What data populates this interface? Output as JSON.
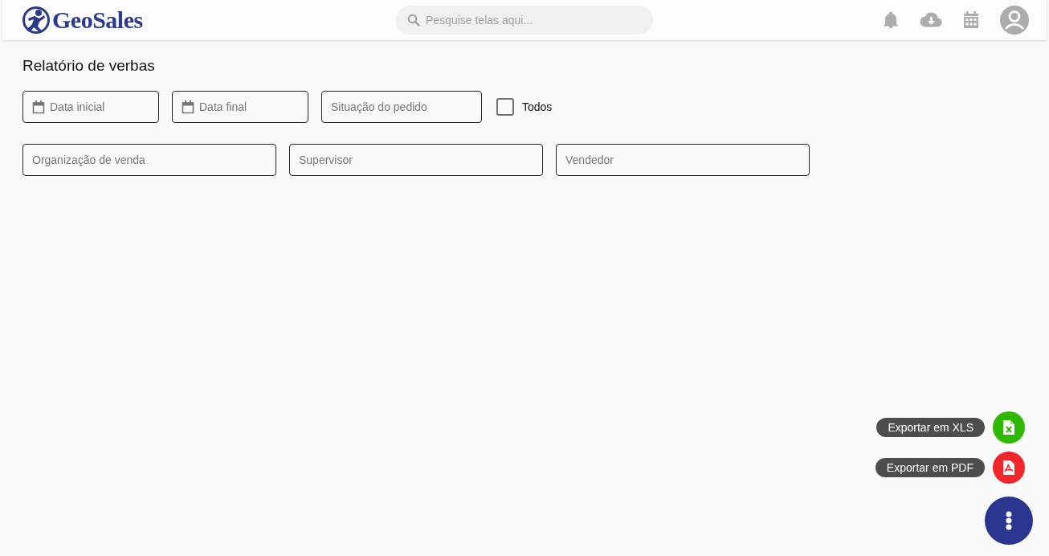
{
  "header": {
    "logo_text": "GeoSales",
    "search": {
      "placeholder": "Pesquise telas aqui..."
    }
  },
  "page_title": "Relatório de verbas",
  "filter_rows": [
    {
      "fields": [
        {
          "kind": "date",
          "placeholder": "Data inicial"
        },
        {
          "kind": "date",
          "placeholder": "Data final"
        },
        {
          "kind": "text",
          "placeholder": "Situação do pedido"
        }
      ],
      "checkbox": {
        "label": "Todos",
        "checked": false
      }
    },
    {
      "fields": [
        {
          "kind": "text",
          "placeholder": "Organização de venda"
        },
        {
          "kind": "text",
          "placeholder": "Supervisor"
        },
        {
          "kind": "text",
          "placeholder": "Vendedor"
        }
      ]
    }
  ],
  "speed_dial": {
    "actions": [
      {
        "kind": "xls",
        "label": "Exportar em XLS",
        "color": "#2eb800"
      },
      {
        "kind": "pdf",
        "label": "Exportar em PDF",
        "color": "#f0262b"
      }
    ]
  }
}
